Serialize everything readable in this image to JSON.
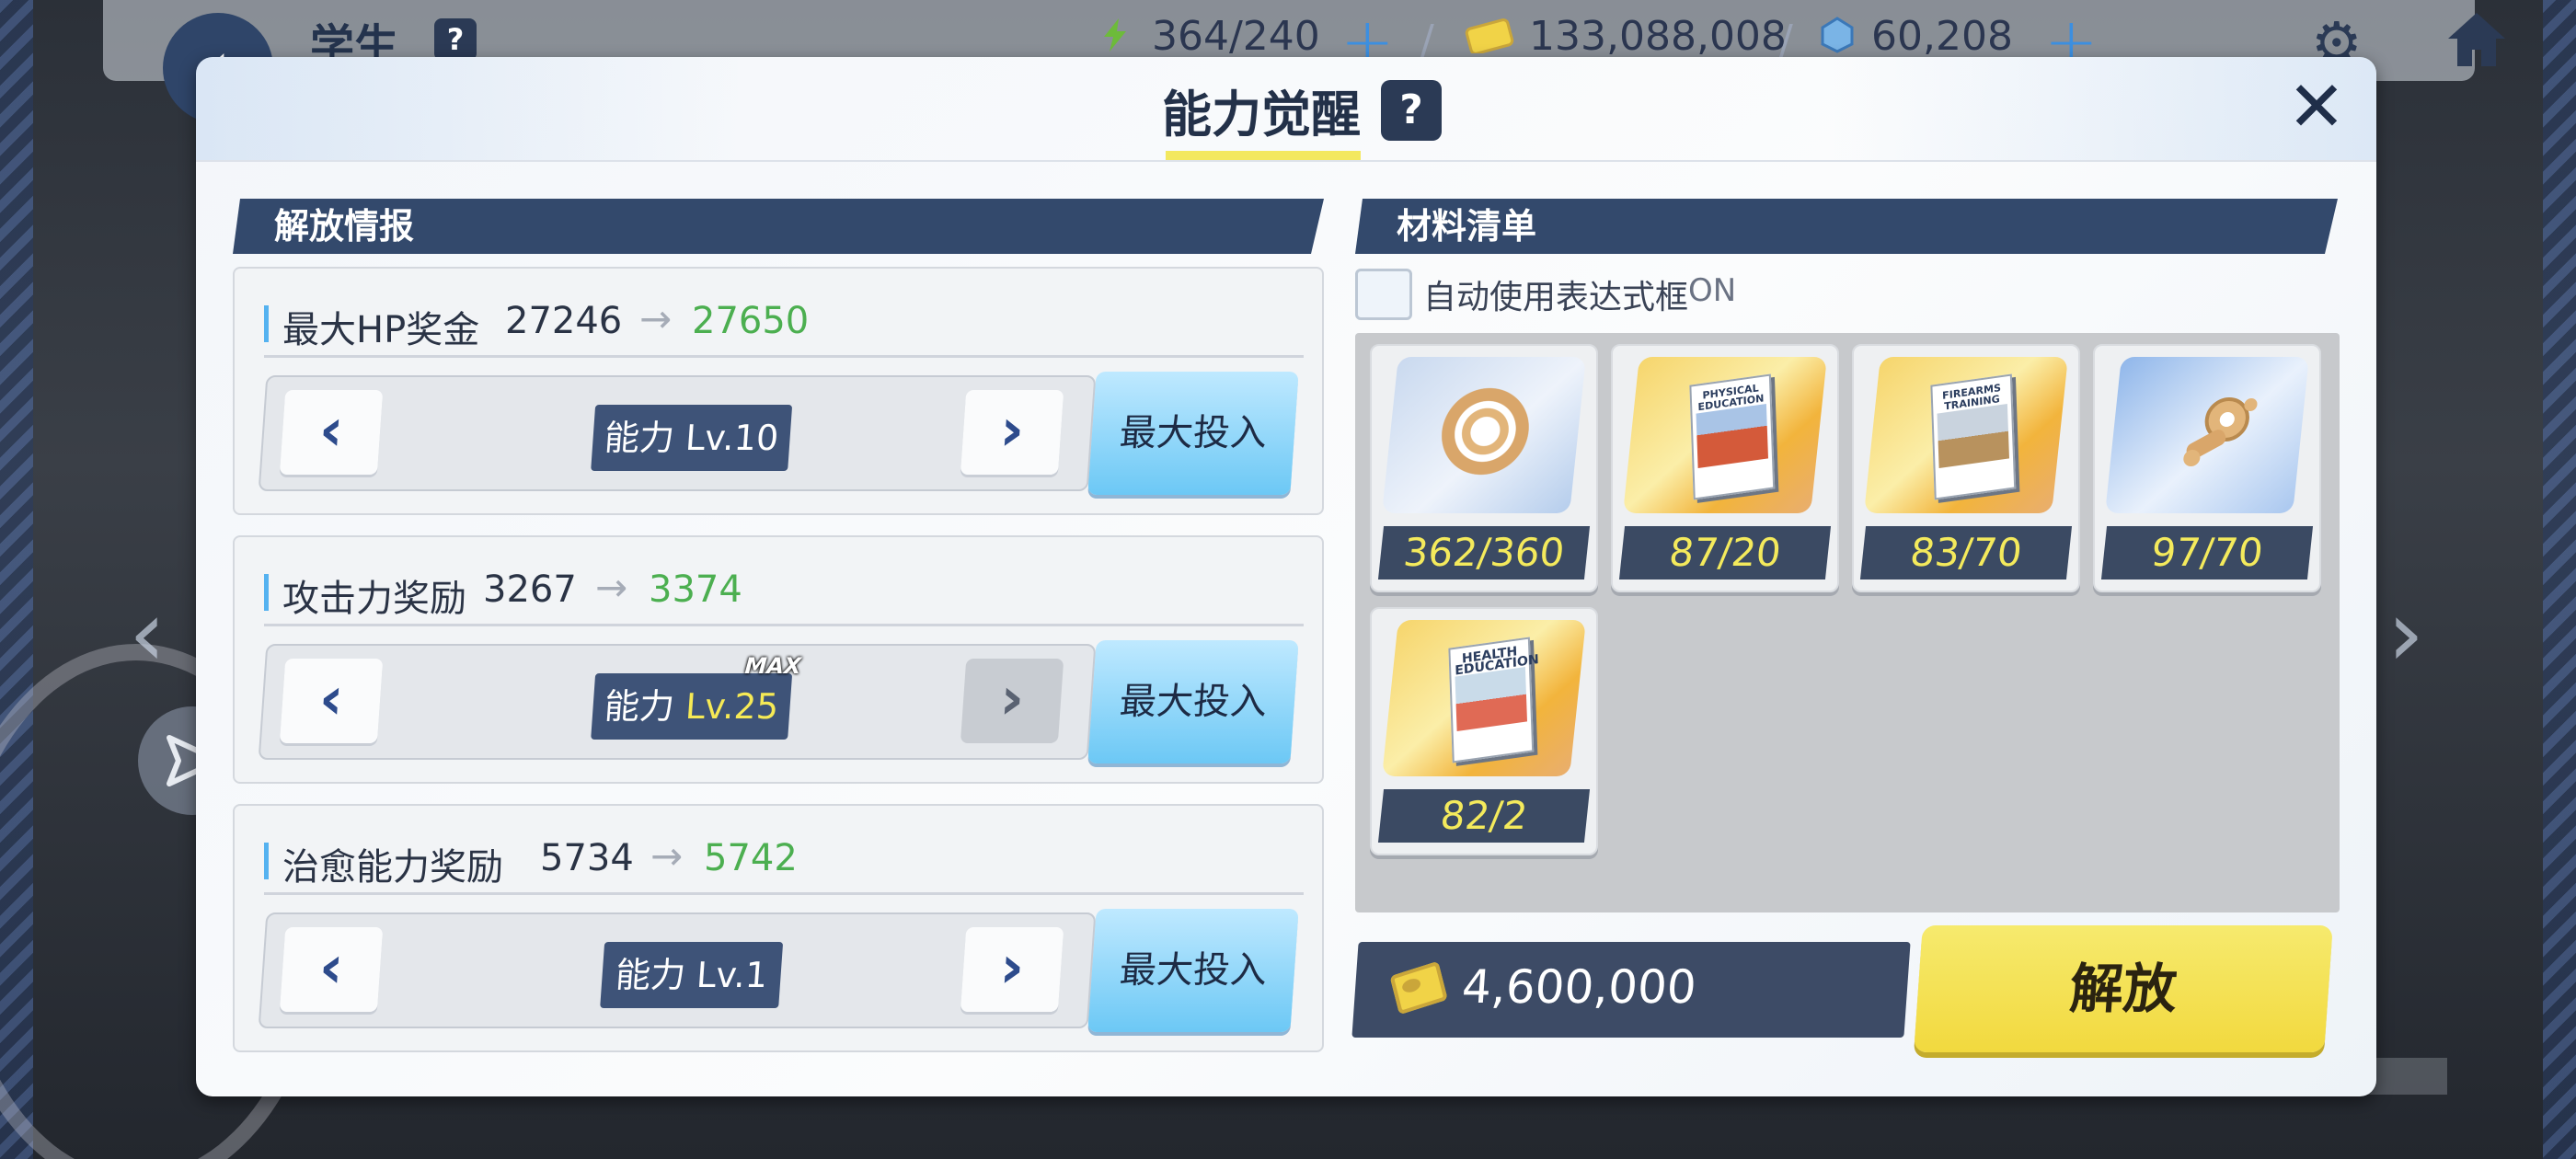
{
  "topbar": {
    "title": "学生",
    "help": "?",
    "ap": "364/240",
    "credits": "133,088,008",
    "gems": "60,208"
  },
  "modal": {
    "title": "能力觉醒",
    "help": "?",
    "close": "✕"
  },
  "left": {
    "section_title": "解放情报",
    "stats": [
      {
        "name": "最大HP奖金",
        "from": "27246",
        "to": "27650",
        "level_prefix": "能力 ",
        "level": "Lv.10",
        "max_tag": "",
        "max_button": "最大投入"
      },
      {
        "name": "攻击力奖励",
        "from": "3267",
        "to": "3374",
        "level_prefix": "能力 ",
        "level": "Lv.25",
        "max_tag": "MAX",
        "max_button": "最大投入"
      },
      {
        "name": "治愈能力奖励",
        "from": "5734",
        "to": "5742",
        "level_prefix": "能力 ",
        "level": "Lv.1",
        "max_tag": "",
        "max_button": "最大投入"
      }
    ]
  },
  "right": {
    "section_title": "材料清单",
    "auto_label": "自动使用表达式框",
    "auto_state": "ON",
    "materials": [
      {
        "icon": "gear-artifact-icon",
        "count": "362/360"
      },
      {
        "icon": "physical-education-book-icon",
        "count": "87/20",
        "book_text": "PHYSICAL EDUCATION"
      },
      {
        "icon": "firearms-training-book-icon",
        "count": "83/70",
        "book_text": "FIREARMS TRAINING"
      },
      {
        "icon": "gold-gadget-icon",
        "count": "97/70"
      },
      {
        "icon": "health-education-book-icon",
        "count": "82/2",
        "book_text": "HEALTH EDUCATION"
      }
    ],
    "cost": "4,600,000",
    "release_button": "解放"
  },
  "colors": {
    "accent_navy": "#33496c",
    "increase_green": "#4caf50",
    "count_yellow": "#f4ea5c",
    "release_yellow": "#f2d93e"
  }
}
